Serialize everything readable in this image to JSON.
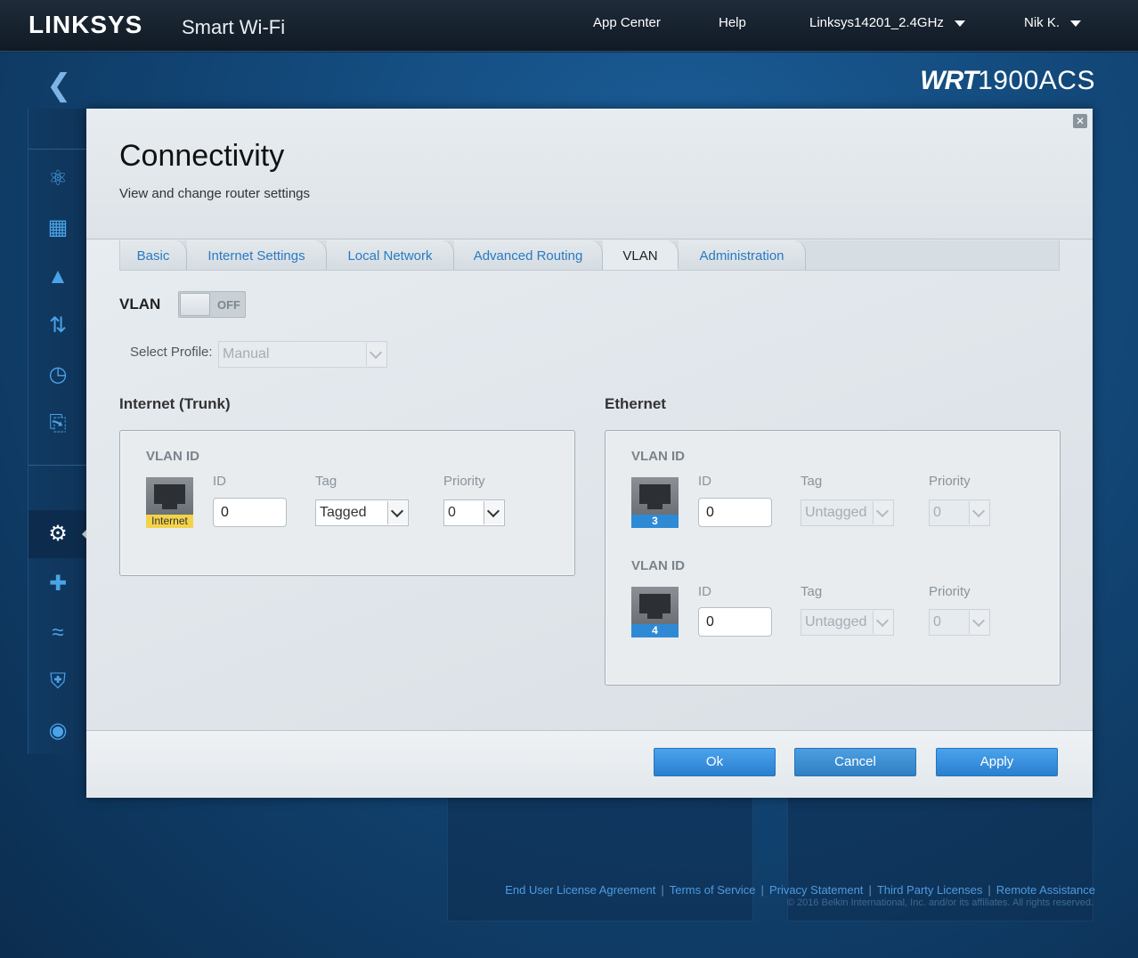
{
  "header": {
    "brand": "LINKSYS",
    "brand_sub": "Smart Wi-Fi",
    "app_center": "App Center",
    "help": "Help",
    "network": "Linksys14201_2.4GHz",
    "user": "Nik K."
  },
  "model": {
    "prefix": "WRT",
    "number": "1900ACS"
  },
  "modal": {
    "title": "Connectivity",
    "subtitle": "View and change router settings",
    "tabs": [
      {
        "label": "Basic",
        "active": false
      },
      {
        "label": "Internet Settings",
        "active": false
      },
      {
        "label": "Local Network",
        "active": false
      },
      {
        "label": "Advanced Routing",
        "active": false
      },
      {
        "label": "VLAN",
        "active": true
      },
      {
        "label": "Administration",
        "active": false
      }
    ],
    "vlan": {
      "label": "VLAN",
      "toggle_state": "OFF",
      "profile_label": "Select Profile:",
      "profile_value": "Manual"
    },
    "internet_trunk": {
      "title": "Internet (Trunk)",
      "vlan_id_heading": "VLAN ID",
      "col_id": "ID",
      "col_tag": "Tag",
      "col_priority": "Priority",
      "port_label": "Internet",
      "id_value": "0",
      "tag_value": "Tagged",
      "priority_value": "0"
    },
    "ethernet": {
      "title": "Ethernet",
      "rows": [
        {
          "vlan_id_heading": "VLAN ID",
          "col_id": "ID",
          "col_tag": "Tag",
          "col_priority": "Priority",
          "port": "3",
          "id_value": "0",
          "tag_value": "Untagged",
          "priority_value": "0"
        },
        {
          "vlan_id_heading": "VLAN ID",
          "col_id": "ID",
          "col_tag": "Tag",
          "col_priority": "Priority",
          "port": "4",
          "id_value": "0",
          "tag_value": "Untagged",
          "priority_value": "0"
        }
      ]
    },
    "buttons": {
      "ok": "Ok",
      "cancel": "Cancel",
      "apply": "Apply"
    }
  },
  "footer": {
    "links": [
      "End User License Agreement",
      "Terms of Service",
      "Privacy Statement",
      "Third Party Licenses",
      "Remote Assistance"
    ],
    "copyright": "© 2016 Belkin International, Inc. and/or its affiliates. All rights reserved."
  },
  "sidebar_icons": [
    "network-map-icon",
    "device-list-icon",
    "alert-icon",
    "speed-test-icon",
    "clock-icon",
    "usb-storage-icon",
    "connectivity-gear-icon",
    "troubleshooting-icon",
    "wireless-icon",
    "security-icon",
    "support-icon"
  ],
  "colors": {
    "accent": "#2a7fd0",
    "link": "#4e9be0",
    "port_internet": "#f3d34a",
    "port_ethernet": "#2f8ad6"
  }
}
